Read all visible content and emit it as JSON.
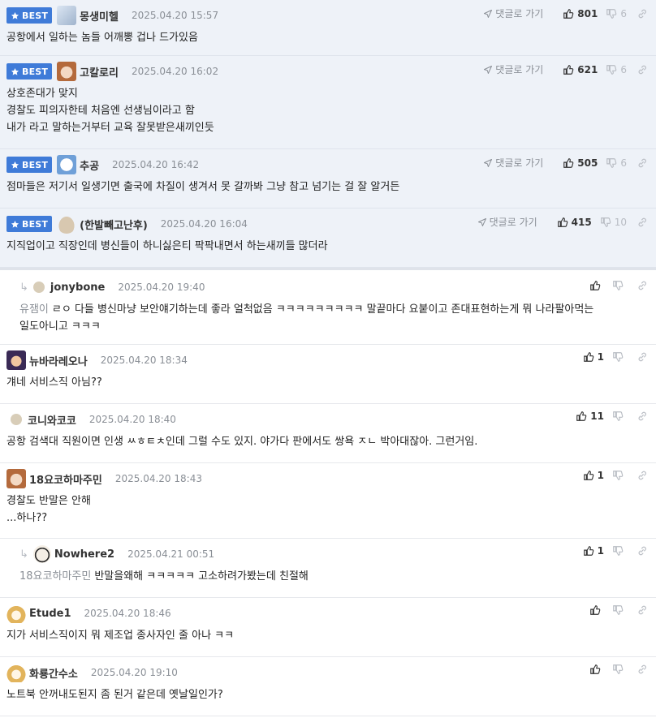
{
  "best_label": "BEST",
  "goto_label": "댓글로 가기",
  "comments": [
    {
      "nick": "몽생미헬",
      "date": "2025.04.20 15:57",
      "up": "801",
      "down": "6",
      "lines": [
        "공항에서 일하는 놈들 어깨뽕 겁나 드가있음"
      ]
    },
    {
      "nick": "고칼로리",
      "date": "2025.04.20 16:02",
      "up": "621",
      "down": "6",
      "lines": [
        "상호존대가 맞지",
        "경찰도 피의자한테 처음엔 선생님이라고 함",
        "내가 라고 말하는거부터 교육 잘못받은새끼인듯"
      ]
    },
    {
      "nick": "추공",
      "date": "2025.04.20 16:42",
      "up": "505",
      "down": "6",
      "lines": [
        "점마들은 저기서 일생기면 출국에 차질이 생겨서 못 갈까봐 그냥 참고 넘기는 걸 잘 알거든"
      ]
    },
    {
      "nick": "(한발빼고난후)",
      "date": "2025.04.20 16:04",
      "up": "415",
      "down": "10",
      "lines": [
        "지직업이고 직장인데 병신들이 하니싫은티 팍팍내면서 하는새끼들 많더라"
      ]
    },
    {
      "nick": "jonybone",
      "date": "2025.04.20 19:40",
      "up": "",
      "down": "",
      "mention": "유잼이",
      "lines": [
        "ㄹㅇ 다들 병신마냥 보안얘기하는데 좋라 얼척없음 ㅋㅋㅋㅋㅋㅋㅋㅋㅋ 말끝마다 요붙이고 존대표현하는게 뭐 나라팔아먹는",
        "일도아니고 ㅋㅋㅋ"
      ]
    },
    {
      "nick": "뉴바라레오나",
      "date": "2025.04.20 18:34",
      "up": "1",
      "down": "",
      "lines": [
        "걔네 서비스직 아님??"
      ]
    },
    {
      "nick": "코니와코코",
      "date": "2025.04.20 18:40",
      "up": "11",
      "down": "",
      "lines": [
        "공항 검색대 직원이면 인생 ㅆㅎㅌㅊ인데 그럴 수도 있지. 야가다 판에서도 쌍욕 ㅈㄴ 박아대잖아. 그런거임."
      ]
    },
    {
      "nick": "18요코하마주민",
      "date": "2025.04.20 18:43",
      "up": "1",
      "down": "",
      "lines": [
        "경찰도 반말은 안해",
        "...하나??"
      ]
    },
    {
      "nick": "Nowhere2",
      "date": "2025.04.21 00:51",
      "up": "1",
      "down": "",
      "mention": "18요코하마주민",
      "lines": [
        "반말을왜해 ㅋㅋㅋㅋㅋ 고소하려가봤는데 친절해"
      ]
    },
    {
      "nick": "Etude1",
      "date": "2025.04.20 18:46",
      "up": "",
      "down": "",
      "lines": [
        "지가 서비스직이지 뭐 제조업 종사자인 줄 아나 ㅋㅋ"
      ]
    },
    {
      "nick": "화룡간수소",
      "date": "2025.04.20 19:10",
      "up": "",
      "down": "",
      "lines": [
        "노트북 안꺼내도된지 좀 된거 같은데 옛날일인가?"
      ]
    }
  ]
}
